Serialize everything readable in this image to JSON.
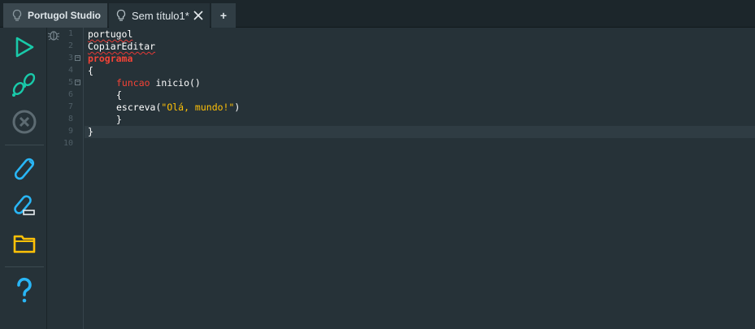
{
  "tabs": {
    "home_label": "Portugol Studio",
    "file_label": "Sem título1*",
    "add_label": "+"
  },
  "gutter": {
    "line_numbers": [
      "1",
      "2",
      "3",
      "4",
      "5",
      "6",
      "7",
      "8",
      "9",
      "10"
    ]
  },
  "code": {
    "line1": "portugol",
    "line2": "CopiarEditar",
    "line3_kw": "programa",
    "line4": "{",
    "line5_kw": "funcao",
    "line5_rest": " inicio()",
    "line6": "{",
    "line7_fn": "escreva(",
    "line7_str": "\"Olá, mundo!\"",
    "line7_end": ")",
    "line8": "}",
    "line9": "}"
  },
  "colors": {
    "background": "#263238",
    "accent_teal": "#19c9a9",
    "accent_blue": "#29b6f6",
    "folder_yellow": "#ffc107",
    "keyword_red": "#f44336"
  },
  "icons": [
    "lightbulb-icon",
    "close-icon",
    "run-icon",
    "step-icon",
    "stop-icon",
    "save-icon",
    "save-as-icon",
    "open-folder-icon",
    "help-icon",
    "debug-bug-icon"
  ]
}
